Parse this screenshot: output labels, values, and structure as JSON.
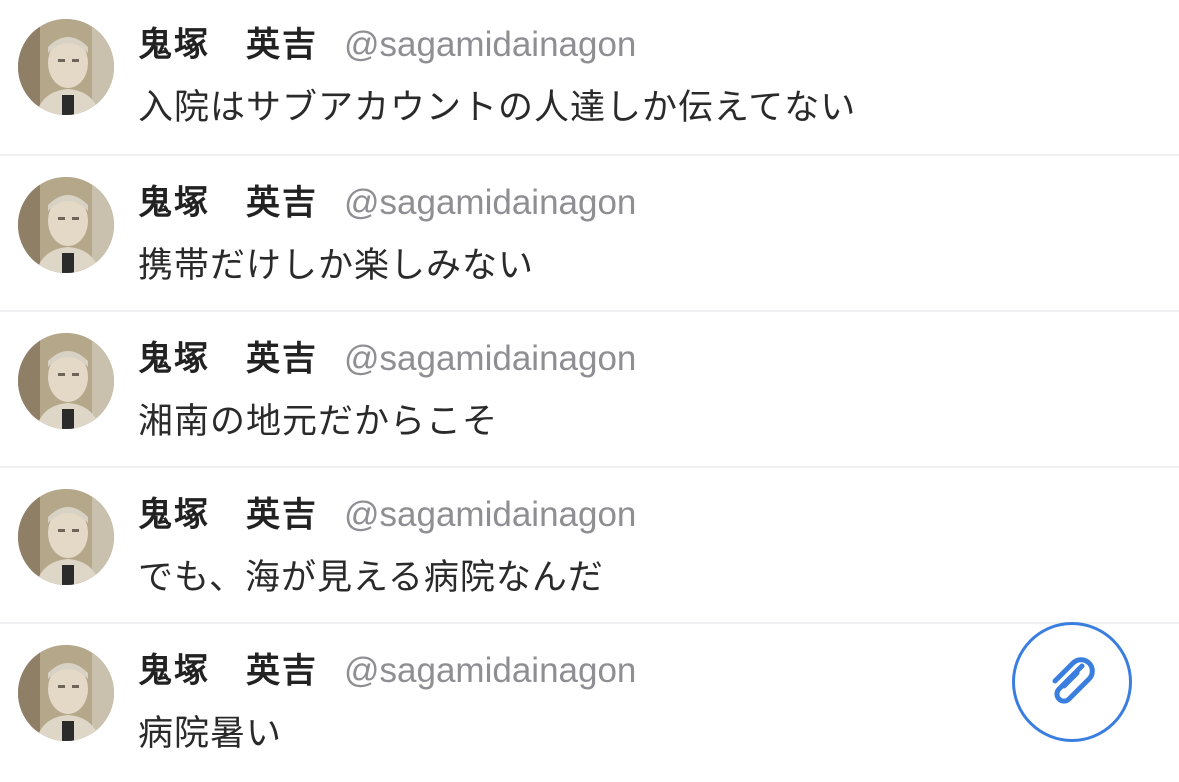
{
  "feed": {
    "posts": [
      {
        "display_name": "鬼塚　英吉",
        "handle": "@sagamidainagon",
        "text": "入院はサブアカウントの人達しか伝えてない"
      },
      {
        "display_name": "鬼塚　英吉",
        "handle": "@sagamidainagon",
        "text": "携帯だけしか楽しみない"
      },
      {
        "display_name": "鬼塚　英吉",
        "handle": "@sagamidainagon",
        "text": "湘南の地元だからこそ"
      },
      {
        "display_name": "鬼塚　英吉",
        "handle": "@sagamidainagon",
        "text": "でも、海が見える病院なんだ"
      },
      {
        "display_name": "鬼塚　英吉",
        "handle": "@sagamidainagon",
        "text": "病院暑い"
      }
    ]
  },
  "attach_button": {
    "icon": "paperclip-icon",
    "color": "#3a7ee0"
  },
  "colors": {
    "name": "#222222",
    "handle": "#8e8e93",
    "text": "#2a2a2a",
    "separator": "#eef0f2"
  }
}
